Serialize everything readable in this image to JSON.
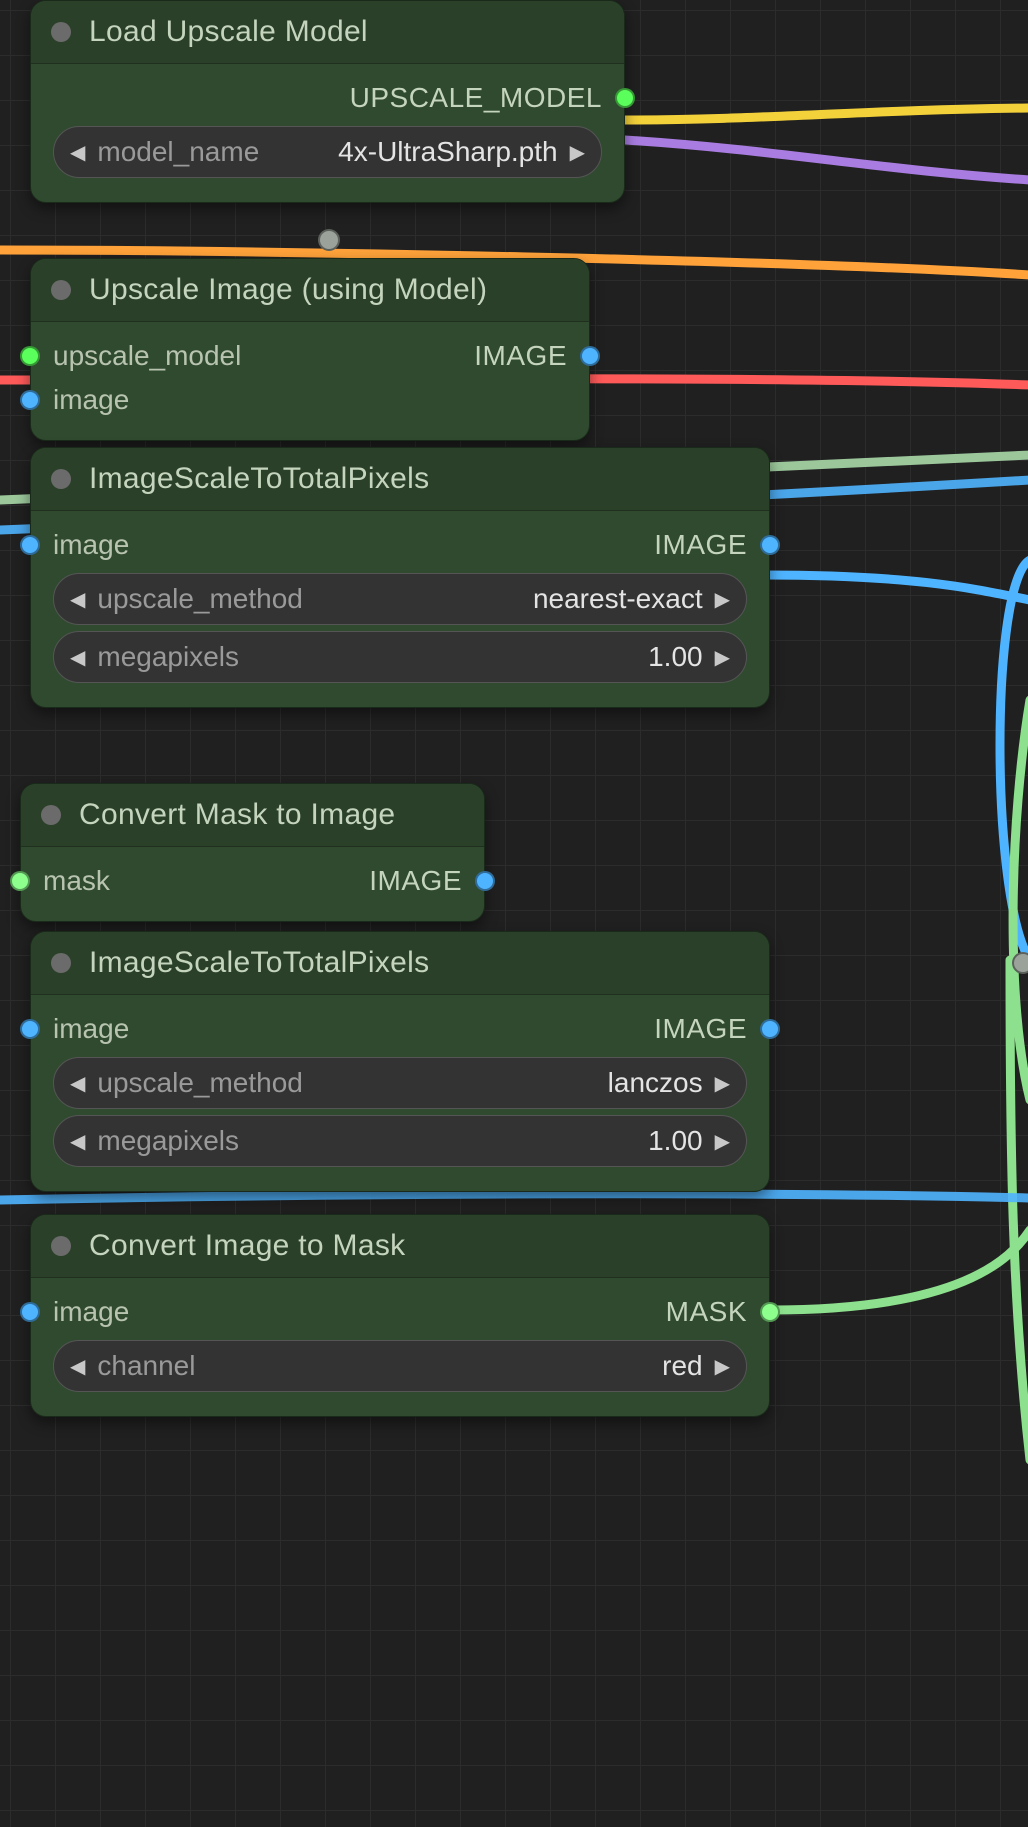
{
  "colors": {
    "socket_image": "#4fb4ff",
    "socket_upscale_model": "#5bff5b",
    "socket_mask": "#8cff8c"
  },
  "wires": [
    {
      "name": "yellow",
      "color": "#f3d13a"
    },
    {
      "name": "purple",
      "color": "#a87ce0"
    },
    {
      "name": "orange",
      "color": "#ffa23a"
    },
    {
      "name": "red",
      "color": "#ff5a5a"
    },
    {
      "name": "green-upper",
      "color": "#8de08d"
    },
    {
      "name": "blue-upper",
      "color": "#4fb4ff"
    },
    {
      "name": "blue-mid",
      "color": "#4fb4ff"
    },
    {
      "name": "green-right",
      "color": "#8de08d"
    },
    {
      "name": "blue-lower",
      "color": "#4fb4ff"
    }
  ],
  "nodes": {
    "load_upscale_model": {
      "title": "Load Upscale Model",
      "outputs": [
        {
          "label": "UPSCALE_MODEL",
          "color": "c-green",
          "name": "output-upscale-model"
        }
      ],
      "widgets": [
        {
          "name": "model_name",
          "value": "4x-UltraSharp.pth"
        }
      ]
    },
    "upscale_image": {
      "title": "Upscale Image (using Model)",
      "inputs": [
        {
          "label": "upscale_model",
          "color": "c-green",
          "name": "input-upscale-model"
        },
        {
          "label": "image",
          "color": "c-blue",
          "name": "input-image"
        }
      ],
      "outputs": [
        {
          "label": "IMAGE",
          "color": "c-blue",
          "name": "output-image"
        }
      ]
    },
    "image_scale_1": {
      "title": "ImageScaleToTotalPixels",
      "inputs": [
        {
          "label": "image",
          "color": "c-blue",
          "name": "input-image"
        }
      ],
      "outputs": [
        {
          "label": "IMAGE",
          "color": "c-blue",
          "name": "output-image"
        }
      ],
      "widgets": [
        {
          "name": "upscale_method",
          "value": "nearest-exact"
        },
        {
          "name": "megapixels",
          "value": "1.00"
        }
      ]
    },
    "convert_mask_to_image": {
      "title": "Convert Mask to Image",
      "inputs": [
        {
          "label": "mask",
          "color": "c-lime",
          "name": "input-mask"
        }
      ],
      "outputs": [
        {
          "label": "IMAGE",
          "color": "c-blue",
          "name": "output-image"
        }
      ]
    },
    "image_scale_2": {
      "title": "ImageScaleToTotalPixels",
      "inputs": [
        {
          "label": "image",
          "color": "c-blue",
          "name": "input-image"
        }
      ],
      "outputs": [
        {
          "label": "IMAGE",
          "color": "c-blue",
          "name": "output-image"
        }
      ],
      "widgets": [
        {
          "name": "upscale_method",
          "value": "lanczos"
        },
        {
          "name": "megapixels",
          "value": "1.00"
        }
      ]
    },
    "convert_image_to_mask": {
      "title": "Convert Image to Mask",
      "inputs": [
        {
          "label": "image",
          "color": "c-blue",
          "name": "input-image"
        }
      ],
      "outputs": [
        {
          "label": "MASK",
          "color": "c-lime",
          "name": "output-mask"
        }
      ],
      "widgets": [
        {
          "name": "channel",
          "value": "red"
        }
      ]
    }
  }
}
